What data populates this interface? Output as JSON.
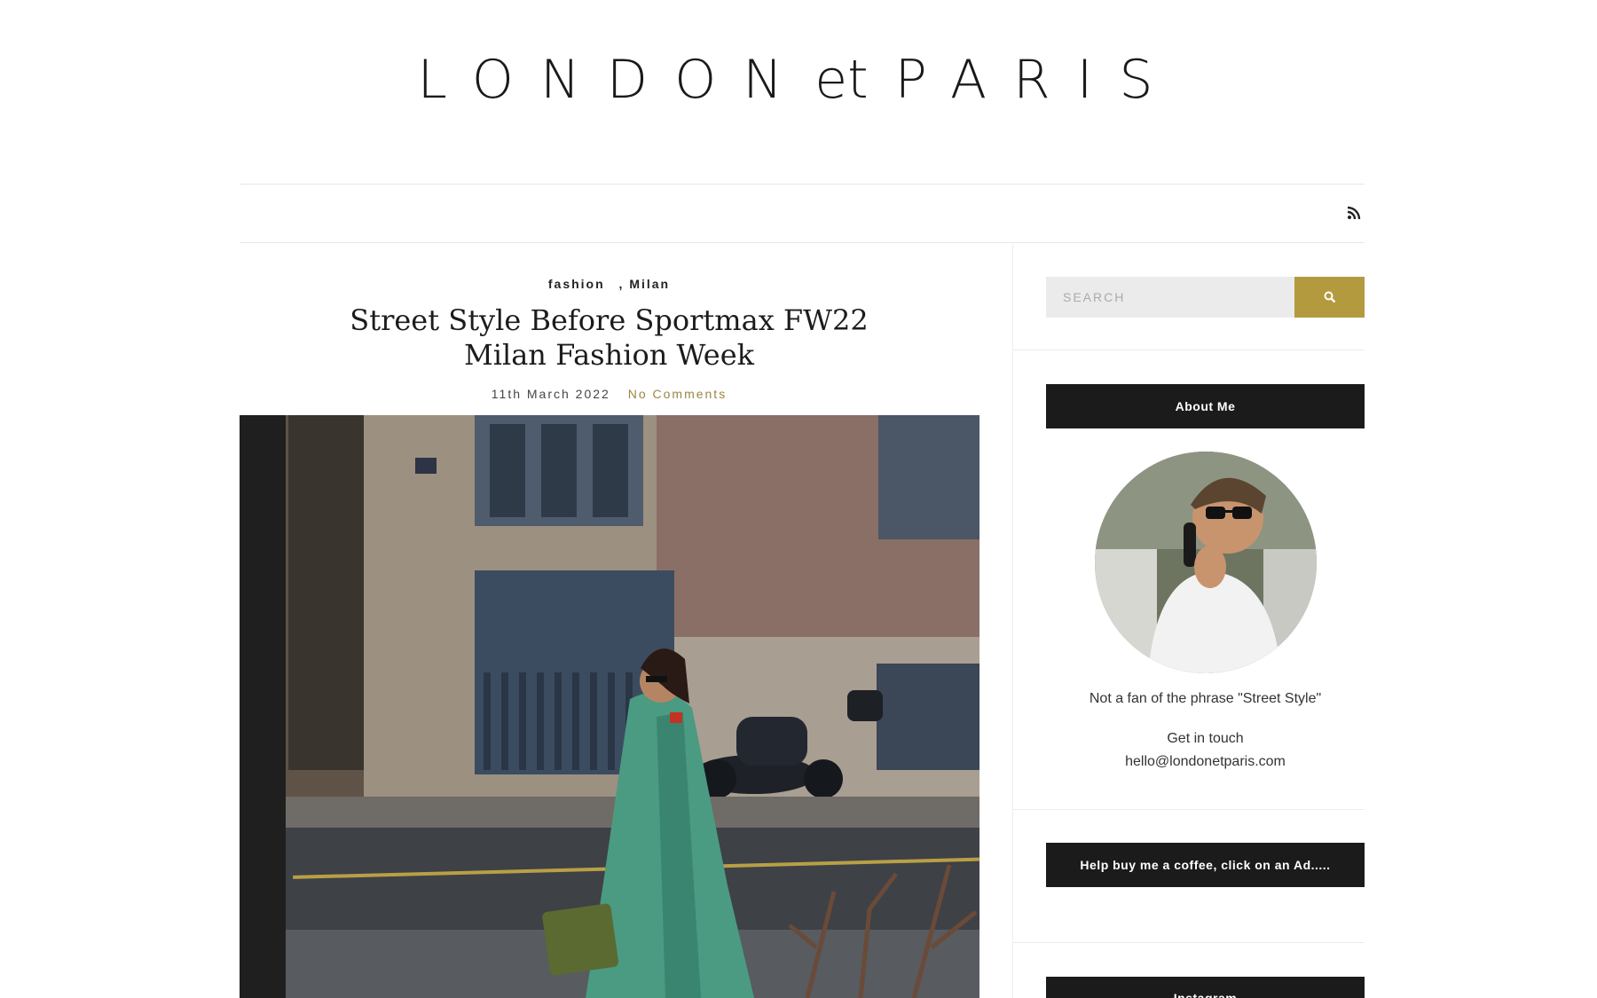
{
  "site": {
    "logo_left": "LONDON",
    "logo_et": "et",
    "logo_right": "PARIS",
    "rss_icon": "rss-icon"
  },
  "post": {
    "category_1": "fashion",
    "category_2": ", Milan",
    "title": "Street Style Before Sportmax FW22 Milan Fashion Week",
    "date": "11th March 2022",
    "comments": "No Comments"
  },
  "sidebar": {
    "search_placeholder": "SEARCH",
    "search_icon": "search-icon",
    "about_title": "About Me",
    "about_tagline": "Not a fan of the phrase \"Street Style\"",
    "get_in_touch": "Get in touch",
    "email": "hello@londonetparis.com",
    "ad_title": "Help buy me a coffee, click on an Ad.....",
    "instagram_title": "Instagram"
  },
  "colors": {
    "accent": "#b49a3e",
    "dark": "#1b1b1b",
    "link": "#9a8644"
  }
}
